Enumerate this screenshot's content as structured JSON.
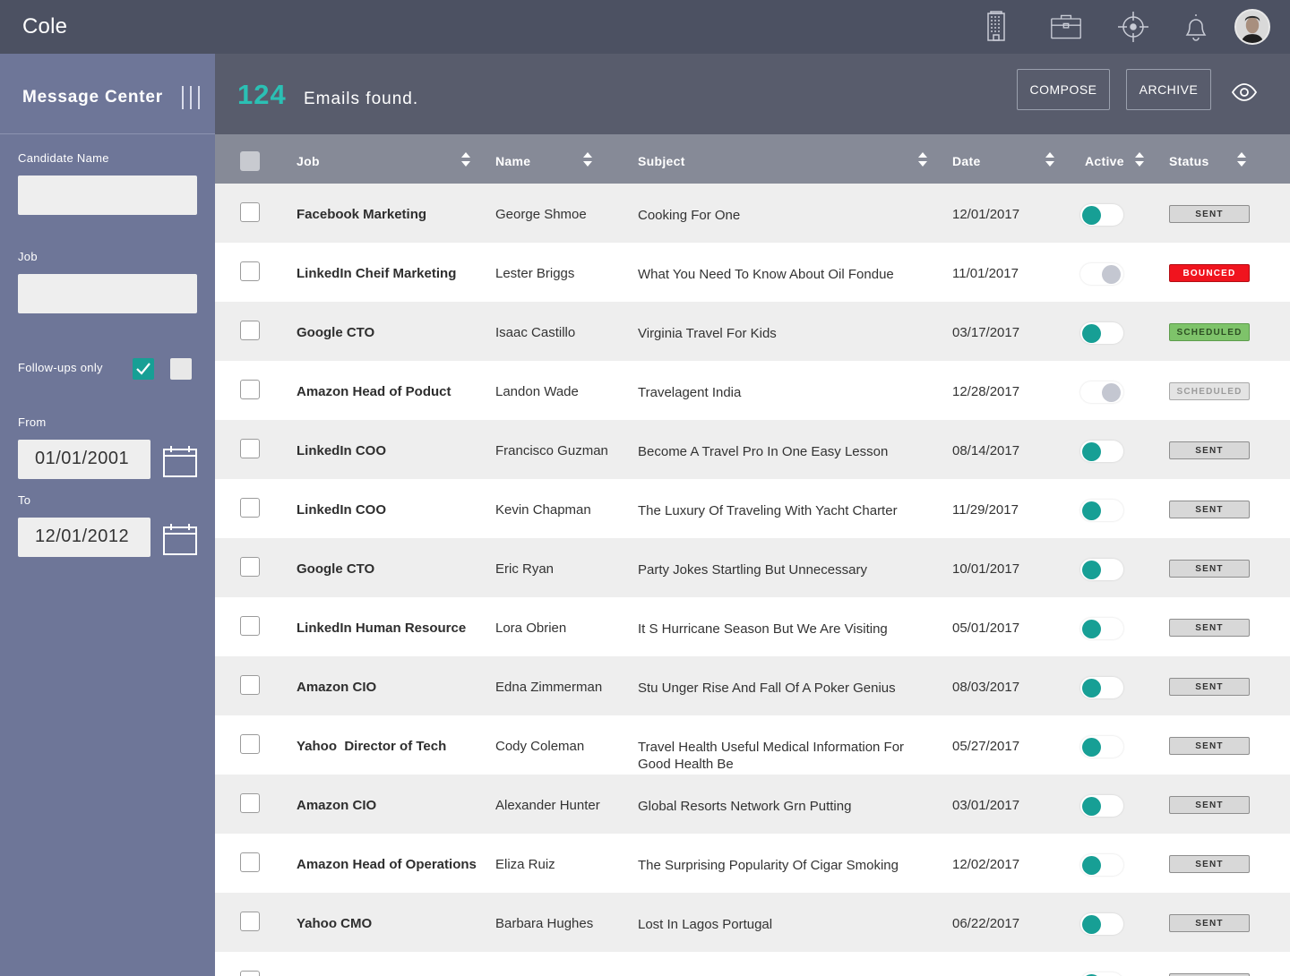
{
  "app": {
    "brand": "Cole"
  },
  "topbar": {
    "icons": [
      "building-icon",
      "briefcase-icon",
      "crosshair-icon",
      "bell-icon"
    ],
    "avatar": "user-avatar"
  },
  "sidebar": {
    "title": "Message Center",
    "candidate_label": "Candidate Name",
    "candidate_value": "",
    "job_label": "Job",
    "job_value": "",
    "followups_label": "Follow-ups only",
    "followups_checked": true,
    "from_label": "From",
    "from_value": "01/01/2001",
    "to_label": "To",
    "to_value": "12/01/2012"
  },
  "header": {
    "count": "124",
    "count_label": "Emails found.",
    "compose_label": "COMPOSE",
    "archive_label": "ARCHIVE"
  },
  "table": {
    "columns": [
      "Job",
      "Name",
      "Subject",
      "Date",
      "Active",
      "Status"
    ],
    "rows": [
      {
        "job": "Facebook Marketing",
        "name": "George Shmoe",
        "subject": "Cooking For One",
        "date": "12/01/2017",
        "active": true,
        "status": "SENT"
      },
      {
        "job": "LinkedIn Cheif Marketing",
        "name": "Lester Briggs",
        "subject": "What You Need To Know About Oil Fondue",
        "date": "11/01/2017",
        "active": false,
        "status": "BOUNCED"
      },
      {
        "job": "Google CTO",
        "name": "Isaac Castillo",
        "subject": "Virginia Travel For Kids",
        "date": "03/17/2017",
        "active": true,
        "status": "SCHEDULED"
      },
      {
        "job": "Amazon Head of Poduct",
        "name": "Landon Wade",
        "subject": "Travelagent India",
        "date": "12/28/2017",
        "active": false,
        "status": "SCHEDULED"
      },
      {
        "job": "LinkedIn COO",
        "name": "Francisco Guzman",
        "subject": "Become A Travel Pro In One Easy Lesson",
        "date": "08/14/2017",
        "active": true,
        "status": "SENT"
      },
      {
        "job": "LinkedIn COO",
        "name": "Kevin Chapman",
        "subject": "The Luxury Of Traveling With Yacht Charter",
        "date": "11/29/2017",
        "active": true,
        "status": "SENT"
      },
      {
        "job": "Google CTO",
        "name": "Eric Ryan",
        "subject": "Party Jokes Startling But Unnecessary",
        "date": "10/01/2017",
        "active": true,
        "status": "SENT"
      },
      {
        "job": "LinkedIn Human Resource",
        "name": "Lora Obrien",
        "subject": "It S Hurricane Season But We Are Visiting",
        "date": "05/01/2017",
        "active": true,
        "status": "SENT"
      },
      {
        "job": "Amazon CIO",
        "name": "Edna Zimmerman",
        "subject": "Stu Unger Rise And Fall Of A Poker Genius",
        "date": "08/03/2017",
        "active": true,
        "status": "SENT"
      },
      {
        "job": "Yahoo  Director of Tech",
        "name": "Cody Coleman",
        "subject": "Travel Health Useful Medical Information For Good Health Be",
        "date": "05/27/2017",
        "active": true,
        "status": "SENT"
      },
      {
        "job": "Amazon CIO",
        "name": "Alexander Hunter",
        "subject": "Global Resorts Network Grn Putting",
        "date": "03/01/2017",
        "active": true,
        "status": "SENT"
      },
      {
        "job": "Amazon Head of Operations",
        "name": "Eliza Ruiz",
        "subject": "The Surprising Popularity Of Cigar Smoking",
        "date": "12/02/2017",
        "active": true,
        "status": "SENT"
      },
      {
        "job": "Yahoo CMO",
        "name": "Barbara Hughes",
        "subject": "Lost In Lagos Portugal",
        "date": "06/22/2017",
        "active": true,
        "status": "SENT"
      },
      {
        "job": "",
        "name": "",
        "subject": "",
        "date": "",
        "active": true,
        "status": ""
      }
    ]
  },
  "colors": {
    "topbar": "#4c5162",
    "sidebar": "#6e7698",
    "accent": "#179f95",
    "count": "#2bc0b4",
    "bounced": "#f0141e",
    "scheduled": "#7ec36a"
  }
}
